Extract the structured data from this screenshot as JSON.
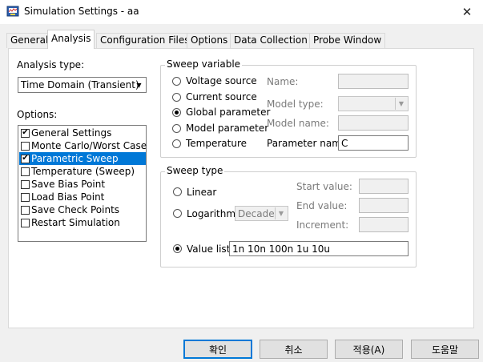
{
  "window": {
    "title": "Simulation Settings - aa",
    "close_glyph": "✕"
  },
  "tabs": [
    {
      "label": "General"
    },
    {
      "label": "Analysis"
    },
    {
      "label": "Configuration Files"
    },
    {
      "label": "Options"
    },
    {
      "label": "Data Collection"
    },
    {
      "label": "Probe Window"
    }
  ],
  "analysis": {
    "analysis_type_label": "Analysis type:",
    "analysis_type_value": "Time Domain (Transient)",
    "options_label": "Options:",
    "options": [
      {
        "label": "General Settings",
        "checked": true,
        "selected": false
      },
      {
        "label": "Monte Carlo/Worst Case",
        "checked": false,
        "selected": false
      },
      {
        "label": "Parametric Sweep",
        "checked": true,
        "selected": true
      },
      {
        "label": "Temperature (Sweep)",
        "checked": false,
        "selected": false
      },
      {
        "label": "Save Bias Point",
        "checked": false,
        "selected": false
      },
      {
        "label": "Load Bias Point",
        "checked": false,
        "selected": false
      },
      {
        "label": "Save Check Points",
        "checked": false,
        "selected": false
      },
      {
        "label": "Restart Simulation",
        "checked": false,
        "selected": false
      }
    ]
  },
  "sweep_variable": {
    "title": "Sweep variable",
    "radios": [
      {
        "label": "Voltage source",
        "checked": false
      },
      {
        "label": "Current source",
        "checked": false
      },
      {
        "label": "Global parameter",
        "checked": true
      },
      {
        "label": "Model parameter",
        "checked": false
      },
      {
        "label": "Temperature",
        "checked": false
      }
    ],
    "name_label": "Name:",
    "model_type_label": "Model type:",
    "model_name_label": "Model name:",
    "parameter_name_label": "Parameter name:",
    "parameter_name_value": "C"
  },
  "sweep_type": {
    "title": "Sweep type",
    "linear_label": "Linear",
    "log_label": "Logarithmic",
    "log_mode_value": "Decade",
    "start_label": "Start value:",
    "end_label": "End value:",
    "increment_label": "Increment:",
    "value_list_label": "Value list",
    "value_list_value": "1n 10n 100n 1u 10u",
    "selected": "value_list"
  },
  "buttons": {
    "ok": "확인",
    "cancel": "취소",
    "apply": "적용(A)",
    "help": "도움말"
  },
  "icons": {
    "app": "simulation-app-icon",
    "dropdown": "▼",
    "check": "✔"
  }
}
